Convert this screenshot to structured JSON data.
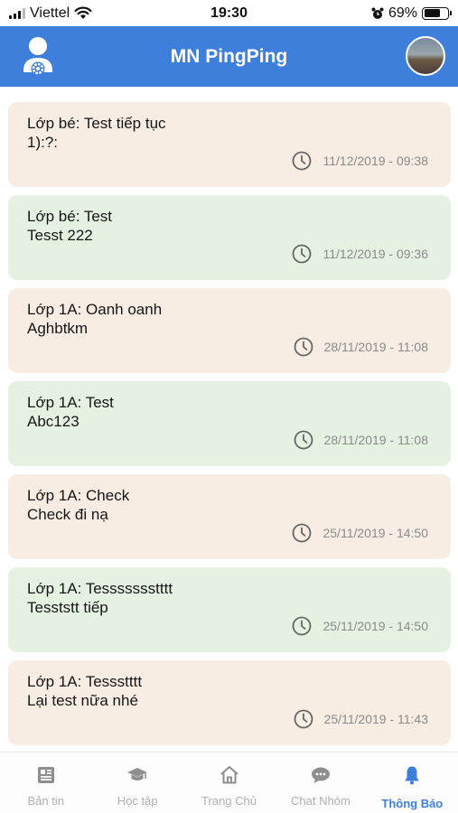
{
  "status": {
    "carrier": "Viettel",
    "time": "19:30",
    "battery_text": "69%",
    "battery_level": 0.69
  },
  "header": {
    "title": "MN PingPing"
  },
  "notifications": [
    {
      "line1": "Lớp bé: Test tiếp tục",
      "line2": "1):?:",
      "time": "11/12/2019 - 09:38",
      "color": "peach"
    },
    {
      "line1": "Lớp bé: Test",
      "line2": "Tesst 222",
      "time": "11/12/2019 - 09:36",
      "color": "green"
    },
    {
      "line1": "Lớp 1A: Oanh oanh",
      "line2": "Aghbtkm",
      "time": "28/11/2019 - 11:08",
      "color": "peach"
    },
    {
      "line1": "Lớp 1A: Test",
      "line2": "Abc123",
      "time": "28/11/2019 - 11:08",
      "color": "green"
    },
    {
      "line1": "Lớp 1A: Check",
      "line2": "Check đi nạ",
      "time": "25/11/2019 - 14:50",
      "color": "peach"
    },
    {
      "line1": "Lớp 1A: Tessssssstttt",
      "line2": "Tesststt tiếp",
      "time": "25/11/2019 - 14:50",
      "color": "green"
    },
    {
      "line1": "Lớp 1A: Tessstttt",
      "line2": "Lại test nữa nhé",
      "time": "25/11/2019 - 11:43",
      "color": "peach"
    }
  ],
  "tabs": [
    {
      "label": "Bản tin",
      "icon": "news-icon"
    },
    {
      "label": "Học tập",
      "icon": "graduation-cap-icon"
    },
    {
      "label": "Trang Chủ",
      "icon": "home-icon"
    },
    {
      "label": "Chat Nhóm",
      "icon": "chat-icon"
    },
    {
      "label": "Thông Báo",
      "icon": "bell-icon",
      "active": true
    }
  ],
  "colors": {
    "primary": "#3f7fdc",
    "card_peach": "#f8ede3",
    "card_green": "#e5f2e2"
  }
}
